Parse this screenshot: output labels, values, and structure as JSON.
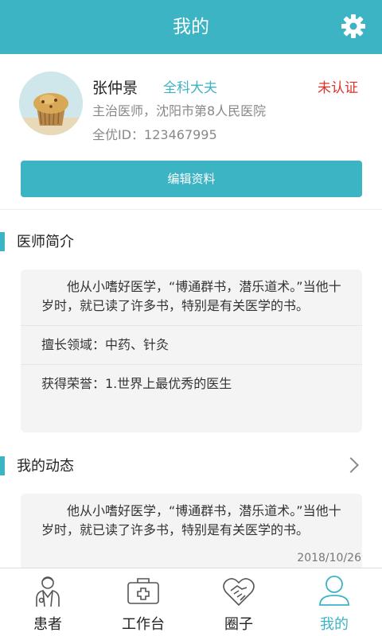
{
  "header": {
    "title": "我的",
    "settings_icon": "gear-icon"
  },
  "profile": {
    "name": "张仲景",
    "role_tag": "全科大夫",
    "status": "未认证",
    "position_hospital": "主治医师，沈阳市第8人民医院",
    "id_text": "全优ID：123467995",
    "edit_button": "编辑资料"
  },
  "intro_section": {
    "title": "医师简介",
    "bio": "他从小嗜好医学，“博通群书，潜乐道术。”当他十岁时，就已读了许多书，特别是有关医学的书。",
    "specialty": "擅长领域：中药、针灸",
    "honors": "获得荣誉：1.世界上最优秀的医生"
  },
  "posts_section": {
    "title": "我的动态",
    "post_text": "他从小嗜好医学，“博通群书，潜乐道术。”当他十岁时，就已读了许多书，特别是有关医学的书。",
    "post_date": "2018/10/26"
  },
  "tabbar": {
    "tabs": [
      {
        "label": "患者",
        "icon": "doctor-icon"
      },
      {
        "label": "工作台",
        "icon": "medical-kit-icon"
      },
      {
        "label": "圈子",
        "icon": "handshake-heart-icon"
      },
      {
        "label": "我的",
        "icon": "person-icon"
      }
    ],
    "active_index": 3
  },
  "colors": {
    "accent": "#3cb4c4",
    "warning": "#e0302a"
  }
}
